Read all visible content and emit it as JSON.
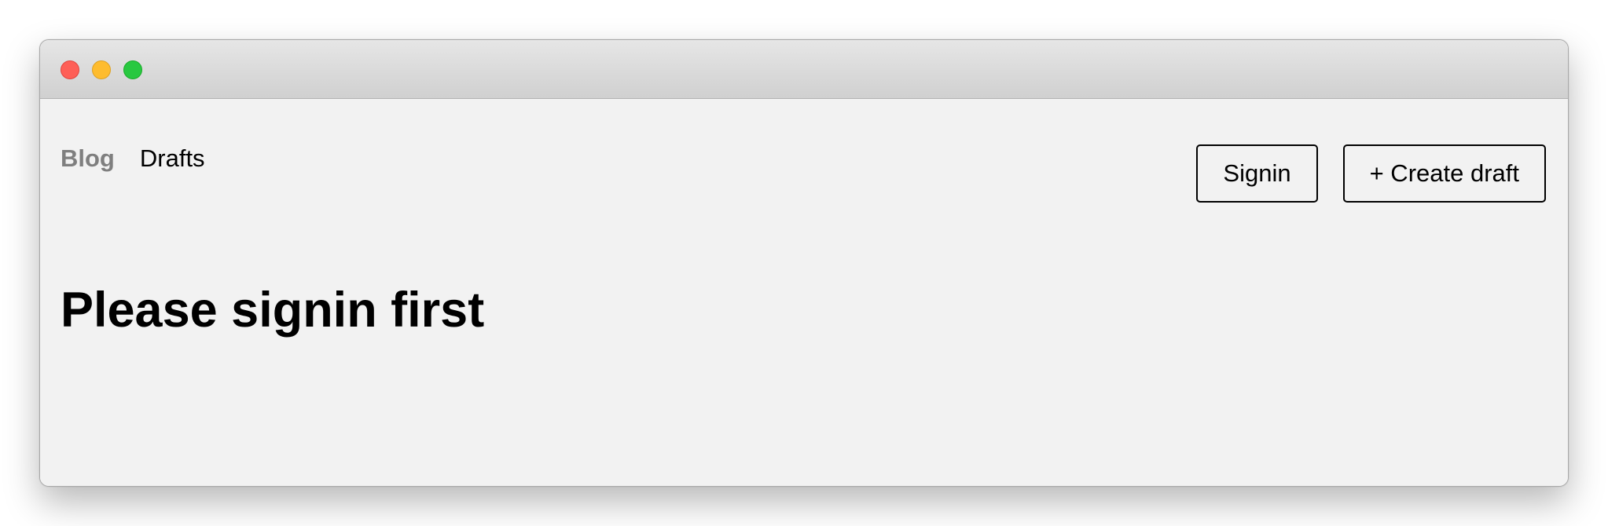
{
  "window": {
    "controls": [
      "close",
      "minimize",
      "zoom"
    ]
  },
  "nav": {
    "brand": "Blog",
    "drafts": "Drafts",
    "signin_label": "Signin",
    "create_draft_label": "+ Create draft"
  },
  "main": {
    "heading": "Please signin first"
  },
  "colors": {
    "background": "#f2f2f2",
    "brand_link": "#7f7f7f",
    "close": "#fe5f57",
    "minimize": "#febc2e",
    "zoom": "#28c840"
  }
}
